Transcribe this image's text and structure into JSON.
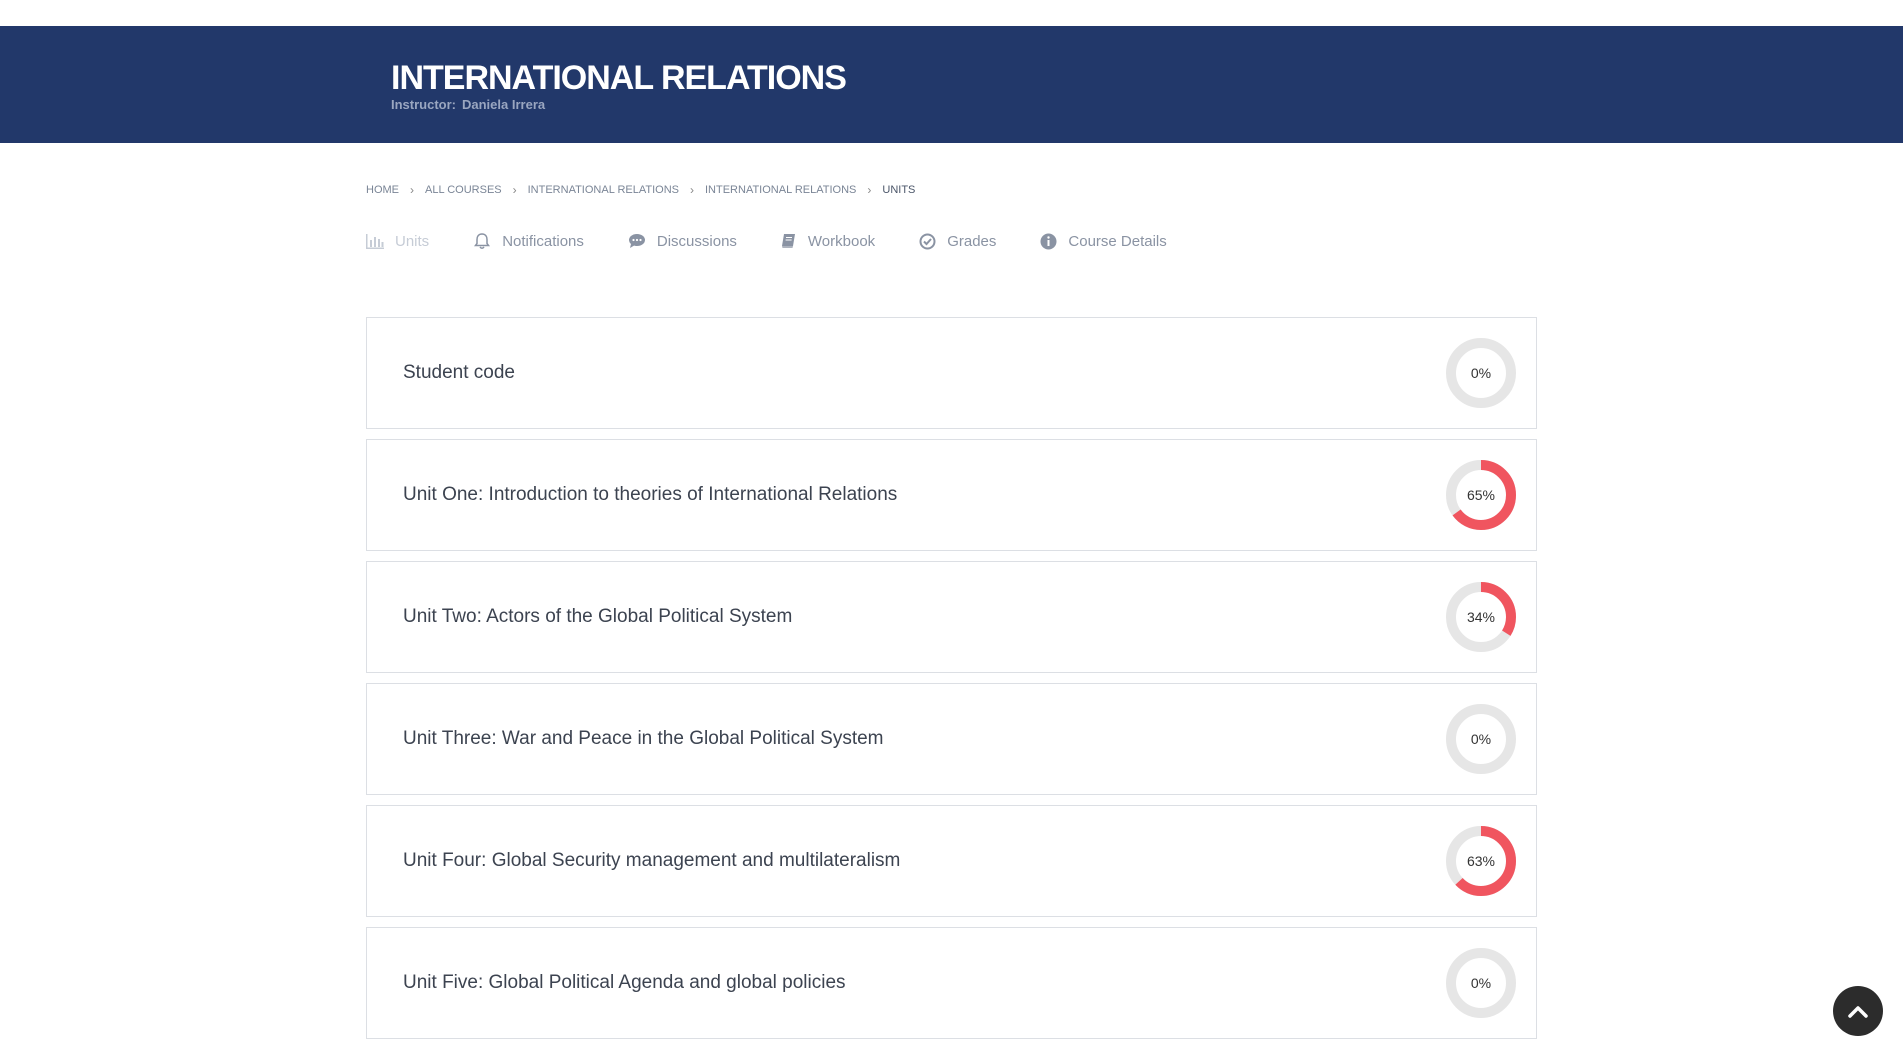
{
  "header": {
    "title": "INTERNATIONAL RELATIONS",
    "instructor_label": "Instructor:",
    "instructor_name": "Daniela Irrera"
  },
  "breadcrumb": [
    "HOME",
    "ALL COURSES",
    "INTERNATIONAL RELATIONS",
    "INTERNATIONAL RELATIONS",
    "UNITS"
  ],
  "tabs": [
    {
      "label": "Units",
      "icon": "bar-chart-icon",
      "active": true
    },
    {
      "label": "Notifications",
      "icon": "bell-icon"
    },
    {
      "label": "Discussions",
      "icon": "chat-icon"
    },
    {
      "label": "Workbook",
      "icon": "book-icon"
    },
    {
      "label": "Grades",
      "icon": "check-circle-icon"
    },
    {
      "label": "Course Details",
      "icon": "info-icon"
    }
  ],
  "units": [
    {
      "title": "Student code",
      "progress": 0,
      "progress_label": "0%"
    },
    {
      "title": "Unit One: Introduction to theories of International Relations",
      "progress": 65,
      "progress_label": "65%"
    },
    {
      "title": "Unit Two: Actors of the Global Political System",
      "progress": 34,
      "progress_label": "34%"
    },
    {
      "title": "Unit Three: War and Peace in the Global Political System",
      "progress": 0,
      "progress_label": "0%"
    },
    {
      "title": "Unit Four: Global Security management and multilateralism",
      "progress": 63,
      "progress_label": "63%"
    },
    {
      "title": "Unit Five: Global Political Agenda and global policies",
      "progress": 0,
      "progress_label": "0%"
    }
  ],
  "colors": {
    "header_bg": "#22386a",
    "progress_fill": "#f0555f",
    "progress_track": "#e6e6e6"
  },
  "scroll_top_icon": "chevron-up-icon"
}
